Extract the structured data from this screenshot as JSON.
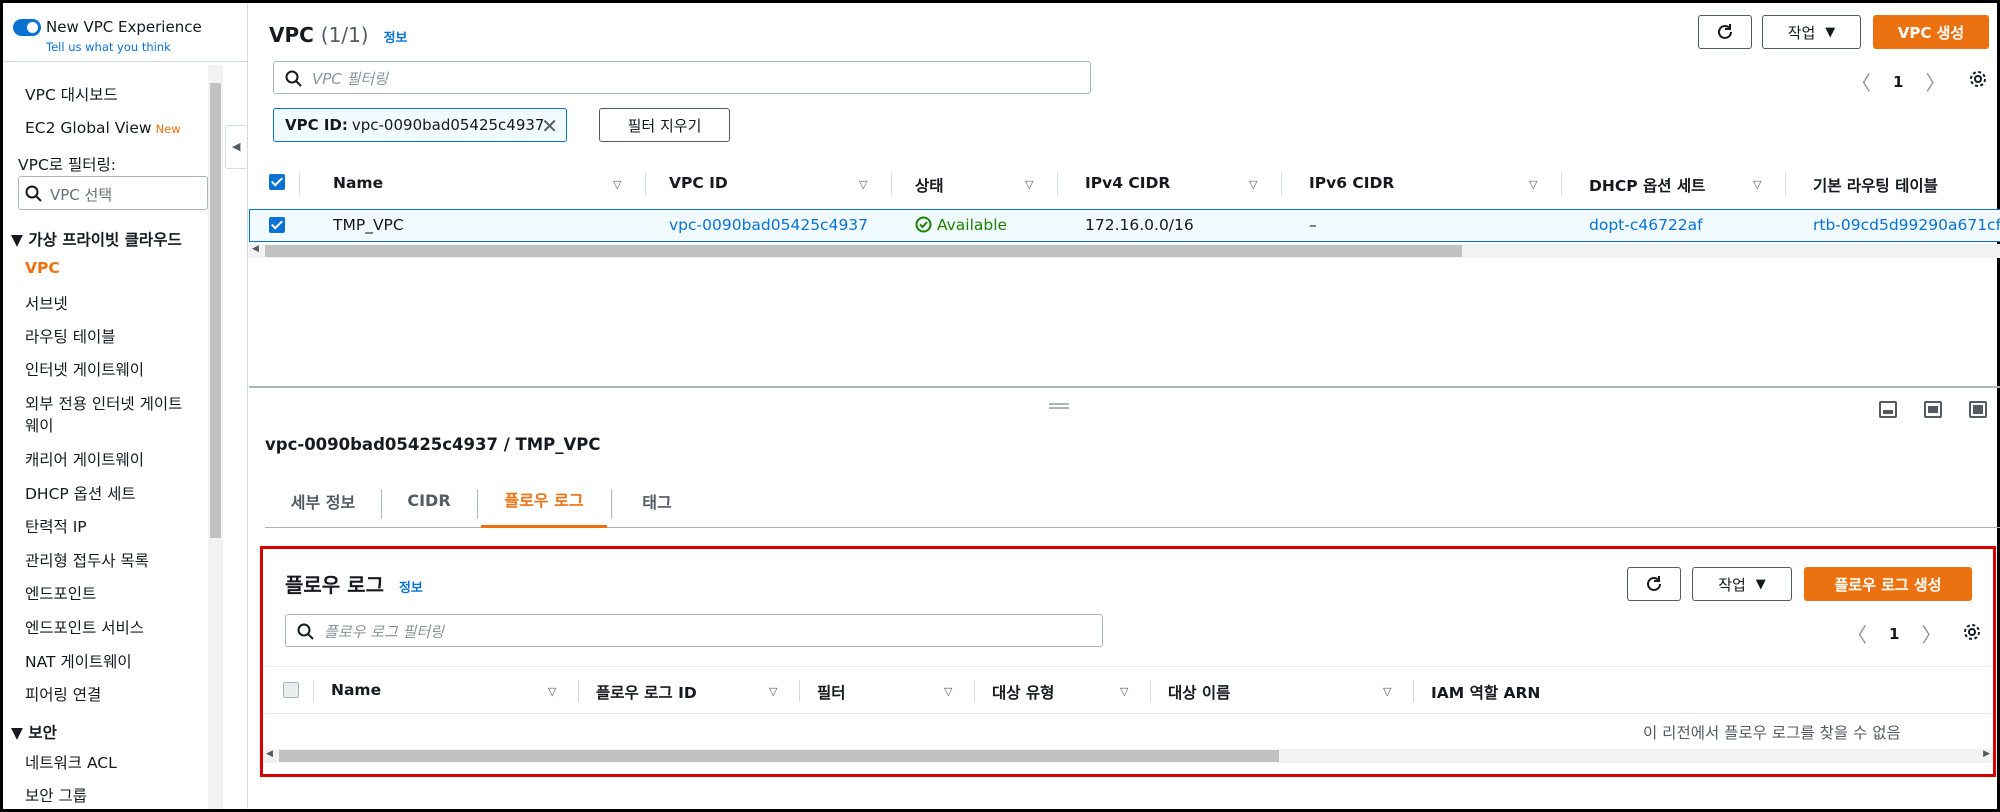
{
  "sidebar": {
    "experience_title": "New VPC Experience",
    "experience_sub": "Tell us what you think",
    "dashboard": "VPC 대시보드",
    "ec2_global": "EC2 Global View",
    "new_badge": "New",
    "filter_label": "VPC로 필터링:",
    "filter_placeholder": "VPC 선택",
    "section_vpc": "▼ 가상 프라이빗 클라우드",
    "items": [
      "VPC",
      "서브넷",
      "라우팅 테이블",
      "인터넷 게이트웨이",
      "외부 전용 인터넷 게이트",
      "웨이",
      "캐리어 게이트웨이",
      "DHCP 옵션 세트",
      "탄력적 IP",
      "관리형 접두사 목록",
      "엔드포인트",
      "엔드포인트 서비스",
      "NAT 게이트웨이",
      "피어링 연결"
    ],
    "section_security": "▼ 보안",
    "security_items": [
      "네트워크 ACL",
      "보안 그룹"
    ]
  },
  "header": {
    "title": "VPC",
    "count": "(1/1)",
    "info": "정보",
    "actions_label": "작업",
    "create_label": "VPC 생성",
    "search_placeholder": "VPC 필터링",
    "page": "1",
    "chip_key": "VPC ID:",
    "chip_value": "vpc-0090bad05425c4937",
    "clear_filters": "필터 지우기"
  },
  "vpc_table": {
    "columns": [
      "Name",
      "VPC ID",
      "상태",
      "IPv4 CIDR",
      "IPv6 CIDR",
      "DHCP 옵션 세트",
      "기본 라우팅 테이블"
    ],
    "row": {
      "name": "TMP_VPC",
      "vpc_id": "vpc-0090bad05425c4937",
      "status": "Available",
      "ipv4": "172.16.0.0/16",
      "ipv6": "–",
      "dhcp": "dopt-c46722af",
      "route_table": "rtb-09cd5d99290a671cf ."
    }
  },
  "details": {
    "title": "vpc-0090bad05425c4937 / TMP_VPC",
    "tabs": [
      "세부 정보",
      "CIDR",
      "플로우 로그",
      "태그"
    ],
    "active_tab": "플로우 로그"
  },
  "flow_logs": {
    "title": "플로우 로그",
    "info": "정보",
    "actions_label": "작업",
    "create_label": "플로우 로그 생성",
    "search_placeholder": "플로우 로그 필터링",
    "page": "1",
    "columns": [
      "Name",
      "플로우 로그 ID",
      "필터",
      "대상 유형",
      "대상 이름",
      "IAM 역할 ARN"
    ],
    "empty_message": "이 리전에서 플로우 로그를 찾을 수 없음"
  },
  "colors": {
    "accent": "#ec7211",
    "link": "#0972d3",
    "highlight_border": "#d90000",
    "status_ok": "#1d8102"
  }
}
